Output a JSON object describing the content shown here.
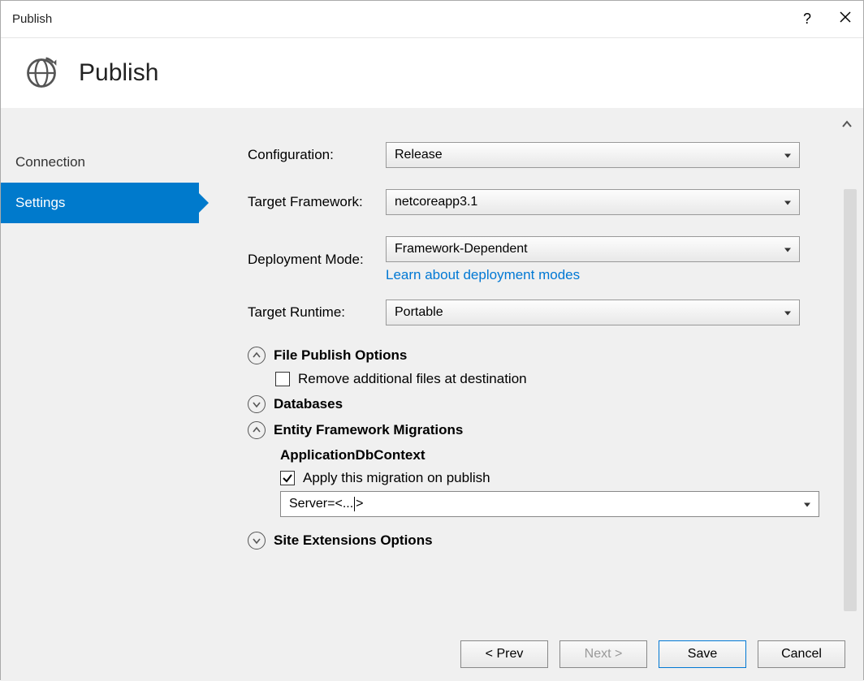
{
  "titlebar": {
    "title": "Publish"
  },
  "header": {
    "title": "Publish"
  },
  "sidebar": {
    "items": [
      {
        "label": "Connection"
      },
      {
        "label": "Settings"
      }
    ]
  },
  "form": {
    "configuration": {
      "label": "Configuration:",
      "value": "Release"
    },
    "target_framework": {
      "label": "Target Framework:",
      "value": "netcoreapp3.1"
    },
    "deployment_mode": {
      "label": "Deployment Mode:",
      "value": "Framework-Dependent",
      "link": "Learn about deployment modes"
    },
    "target_runtime": {
      "label": "Target Runtime:",
      "value": "Portable"
    }
  },
  "sections": {
    "file_publish": {
      "title": "File Publish Options",
      "remove_files": "Remove additional files at destination"
    },
    "databases": {
      "title": "Databases"
    },
    "ef_migrations": {
      "title": "Entity Framework Migrations",
      "context_name": "ApplicationDbContext",
      "apply_label": "Apply this migration on publish",
      "connection_value": "Server=<...>"
    },
    "site_extensions": {
      "title": "Site Extensions Options"
    }
  },
  "footer": {
    "prev": "< Prev",
    "next": "Next >",
    "save": "Save",
    "cancel": "Cancel"
  }
}
